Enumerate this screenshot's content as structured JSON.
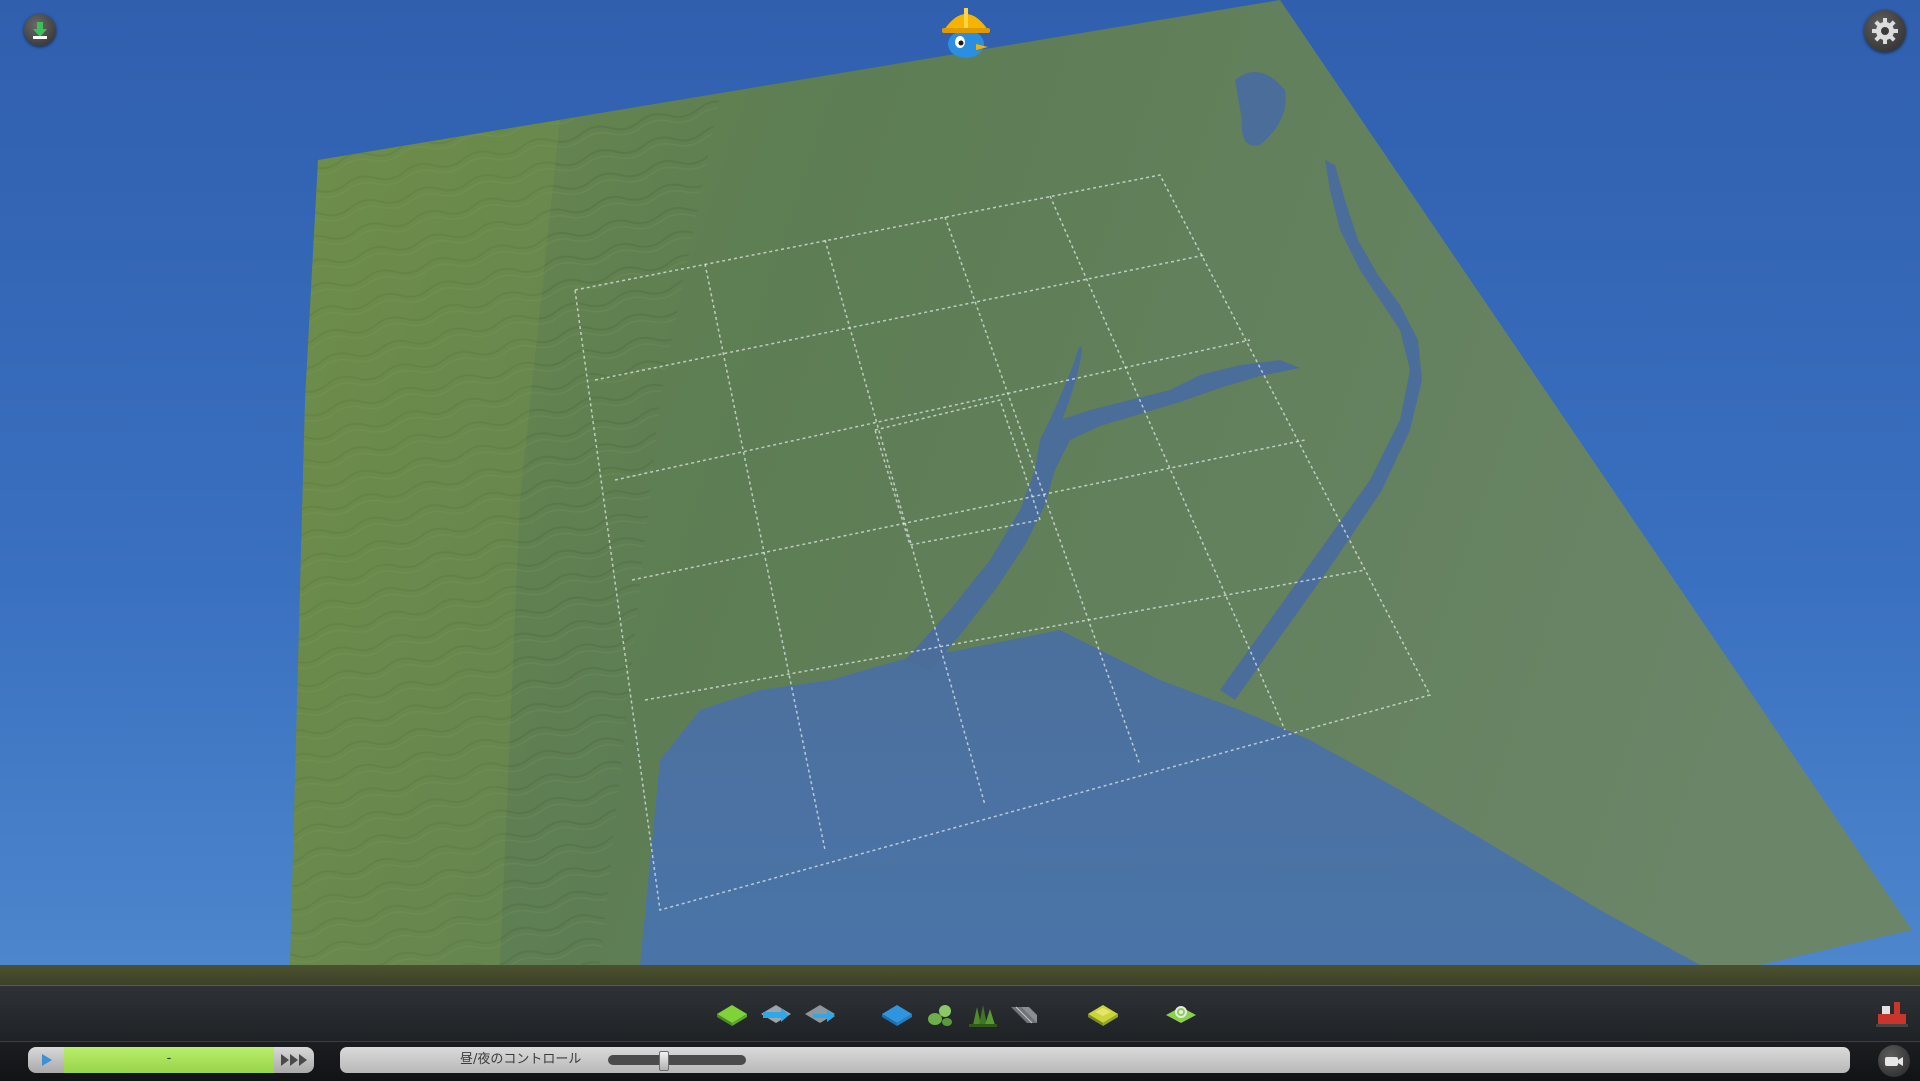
{
  "hud": {
    "unlock_icon": "unlock-icon",
    "settings_icon": "gear-icon",
    "mascot_icon": "chirper-hardhat-icon"
  },
  "colors": {
    "sky": "#3566b4",
    "land": "#5f7d55",
    "water": "#4a72a5",
    "grid": "#e8eef0",
    "date_bar": "#a6df55"
  },
  "toolbar": {
    "tools": [
      {
        "id": "terrain",
        "icon": "terrain-tool-icon"
      },
      {
        "id": "water-flow",
        "icon": "water-flow-tool-icon"
      },
      {
        "id": "water-source",
        "icon": "water-source-tool-icon"
      },
      {
        "id": "water-level",
        "icon": "water-level-tool-icon"
      },
      {
        "id": "ore-resources",
        "icon": "ore-resources-icon"
      },
      {
        "id": "trees",
        "icon": "trees-icon"
      },
      {
        "id": "roads",
        "icon": "roads-icon"
      },
      {
        "id": "land-areas",
        "icon": "land-areas-icon"
      },
      {
        "id": "environment",
        "icon": "environment-icon"
      }
    ],
    "right_icon": "outside-connections-icon"
  },
  "status": {
    "date_text": "-",
    "daynight_label": "昼/夜のコントロール",
    "daynight_value": 0.4,
    "play_icon": "play-icon",
    "speed_icon": "fast-forward-icon",
    "camera_icon": "camera-icon"
  }
}
